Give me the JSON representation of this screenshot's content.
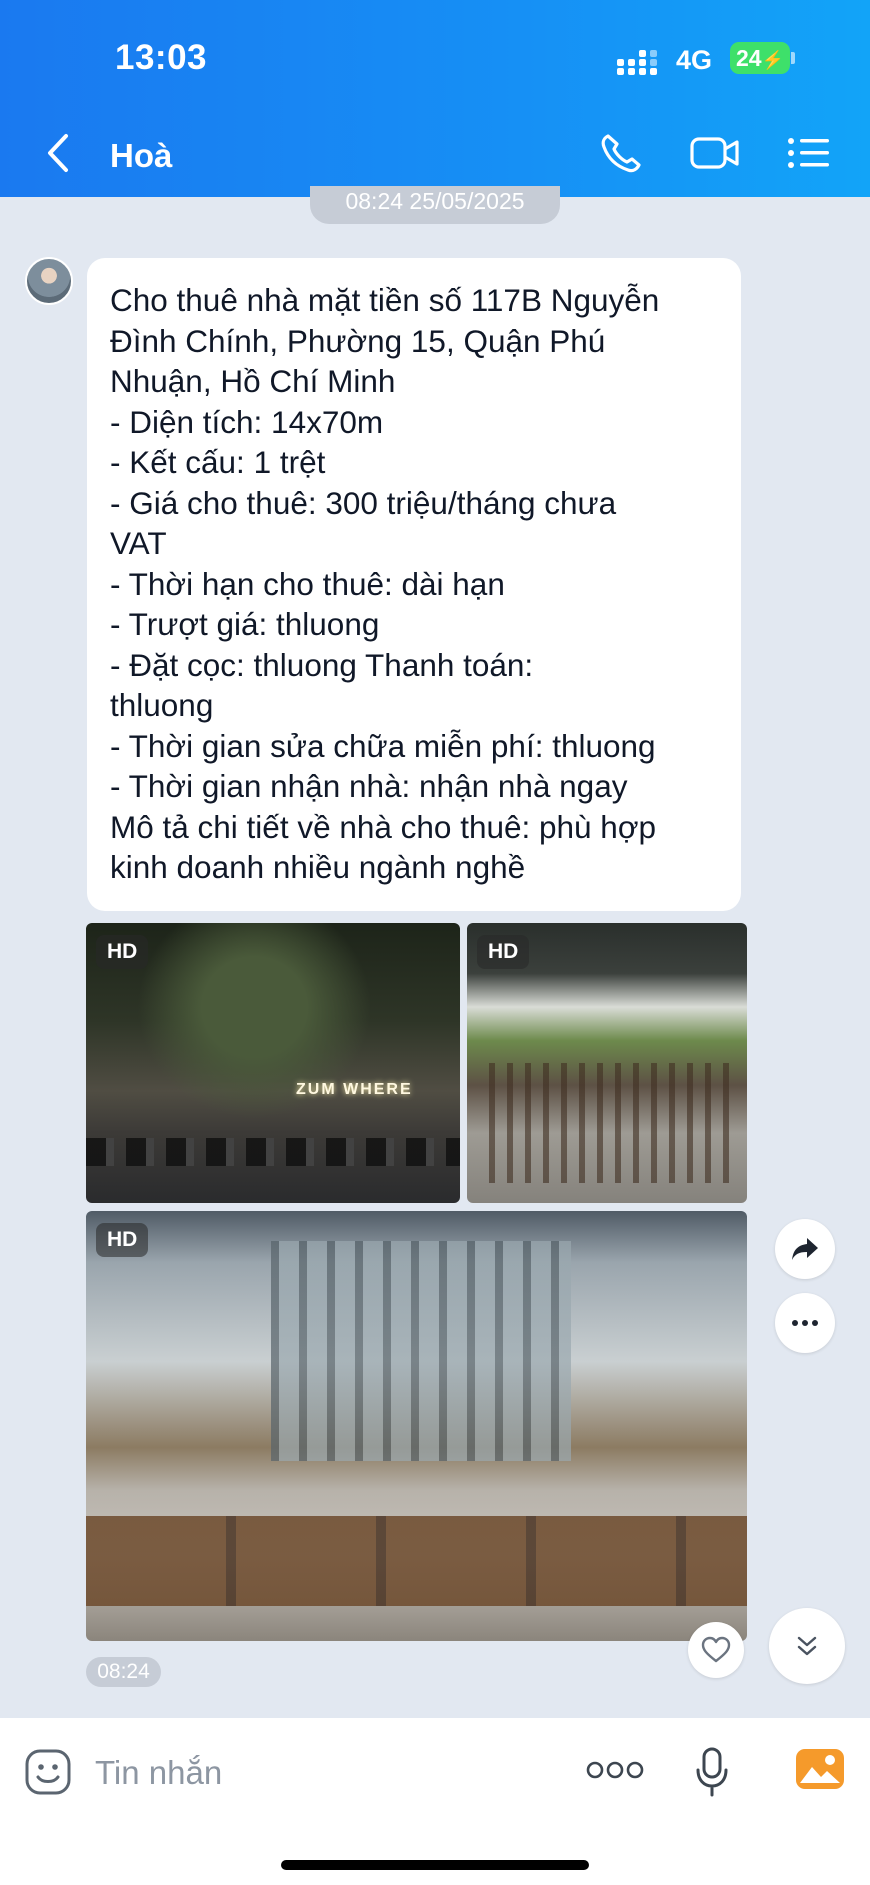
{
  "status_bar": {
    "time": "13:03",
    "network": "4G",
    "battery": "24"
  },
  "header": {
    "contact_name": "Hoà"
  },
  "chat": {
    "date_separator": "08:24 25/05/2025",
    "message_lines": [
      "Cho thuê nhà mặt tiền số 117B Nguyễn",
      "Đình Chính, Phường 15, Quận Phú",
      "Nhuận, Hồ Chí Minh",
      "- Diện tích: 14x70m",
      "- Kết cấu: 1 trệt",
      "- Giá cho thuê: 300 triệu/tháng chưa",
      "VAT",
      "- Thời hạn cho thuê: dài hạn",
      "- Trượt giá: thluong",
      "- Đặt cọc:  thluong Thanh toán:",
      "thluong",
      "- Thời gian sửa chữa miễn phí: thluong",
      "- Thời gian nhận nhà: nhận nhà ngay",
      "Mô tả chi tiết về nhà cho thuê: phù hợp",
      "kinh doanh nhiều ngành nghề"
    ],
    "photos": [
      {
        "badge": "HD",
        "sign_text": "ZUM WHERE"
      },
      {
        "badge": "HD"
      },
      {
        "badge": "HD"
      }
    ],
    "message_time": "08:24"
  },
  "composer": {
    "placeholder": "Tin nhắn"
  },
  "colors": {
    "header_blue": "#1a79f0",
    "chat_bg": "#e2e8f1",
    "battery_green": "#3ee06a"
  }
}
